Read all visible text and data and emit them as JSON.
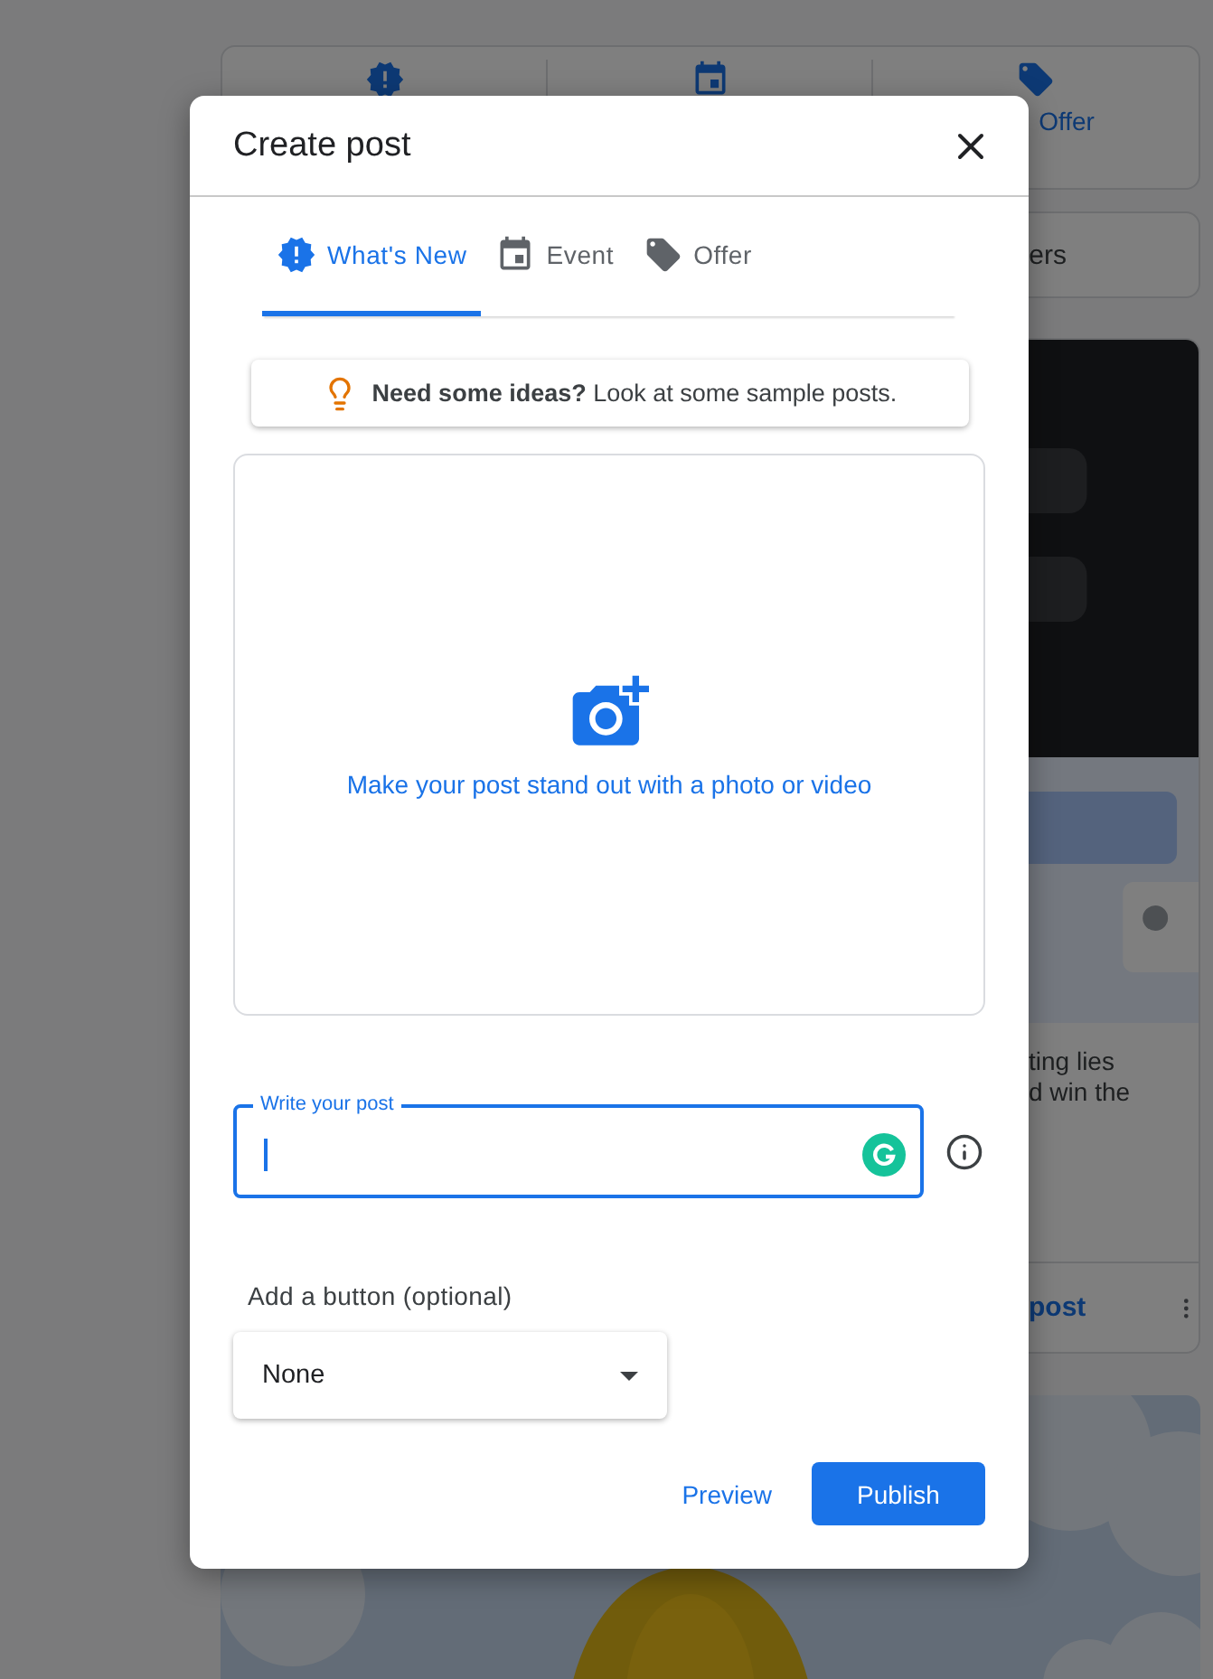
{
  "background": {
    "tabs": [
      {
        "kind": "update"
      },
      {
        "kind": "event"
      },
      {
        "kind": "offer",
        "label": "Offer"
      }
    ],
    "filter_button": "ers",
    "post_card": {
      "lines": [
        "ting lies",
        "d win the"
      ],
      "link": "post"
    }
  },
  "dialog": {
    "title": "Create post",
    "tabs": [
      {
        "label": "What's New",
        "selected": true,
        "kind": "update"
      },
      {
        "label": "Event",
        "selected": false,
        "kind": "event"
      },
      {
        "label": "Offer",
        "selected": false,
        "kind": "offer"
      }
    ],
    "ideas": "**Need some ideas?** Look at some sample posts.",
    "media_prompt": "Make your post stand out with a photo or video",
    "post_field": {
      "label": "Write your post",
      "focused": true
    },
    "button_select": {
      "label": "Add a button (optional)",
      "value": "None"
    },
    "actions": {
      "preview": "Preview",
      "publish": "Publish"
    }
  }
}
